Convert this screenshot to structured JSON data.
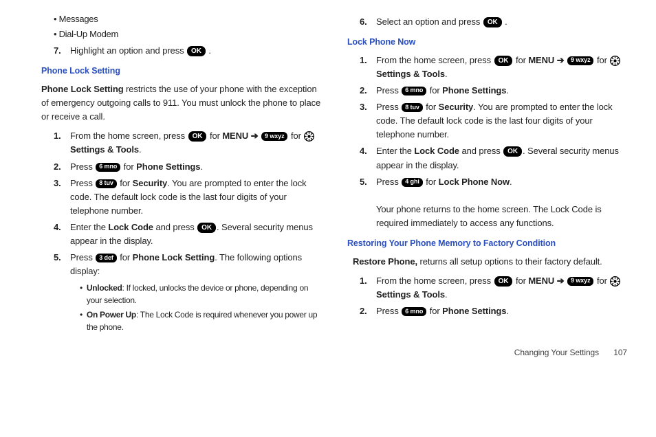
{
  "keys": {
    "ok": "OK",
    "k3": "3 def",
    "k4": "4 ghi",
    "k6": "6 mno",
    "k8": "8 tuv",
    "k9": "9 wxyz"
  },
  "labels": {
    "menu": "MENU",
    "settingsTools": "Settings & Tools",
    "phoneSettings": "Phone Settings",
    "security": "Security",
    "lockCode": "Lock Code",
    "phoneLockSetting": "Phone Lock Setting",
    "lockPhoneNow": "Lock Phone Now",
    "for": "for",
    "press": "Press",
    "enterThe": "Enter the",
    "andPress": "and press",
    "selectOptionPress": "Select an option and press",
    "fromHome": "From the home screen, press"
  },
  "left": {
    "bullets": [
      "Messages",
      "Dial-Up Modem"
    ],
    "step7": {
      "n": "7.",
      "pre": "Highlight an option and press"
    },
    "title1": "Phone Lock Setting",
    "intro_pre": "Phone Lock Setting",
    "intro_rest": " restricts the use of your phone with the exception of emergency outgoing calls to 911. You must unlock the phone to place or receive a call.",
    "steps": {
      "s1n": "1.",
      "s2n": "2.",
      "s3n": "3.",
      "s4n": "4.",
      "s5n": "5.",
      "s3_rest": ". You are prompted to enter the lock code. The default lock code is the last four digits of your telephone number.",
      "s4_rest": ". Several security menus appear in the display.",
      "s5_rest": ". The following options display:"
    },
    "subs": {
      "a_b": "Unlocked",
      "a_t": ": If locked, unlocks the device or phone, depending on your selection.",
      "b_b": "On Power Up",
      "b_t": ": The Lock Code is required whenever you power up the phone."
    }
  },
  "right": {
    "step6": {
      "n": "6."
    },
    "title1": "Lock Phone Now",
    "steps": {
      "s1n": "1.",
      "s2n": "2.",
      "s3n": "3.",
      "s4n": "4.",
      "s5n": "5.",
      "s3_rest": ". You are prompted to enter the lock code. The default lock code is the last four digits of your telephone number.",
      "s4_rest": ". Several security menus appear in the display.",
      "s5_after": "Your phone returns to the home screen. The Lock Code is required immediately to access any functions."
    },
    "title2": "Restoring Your Phone Memory to Factory Condition",
    "restore_b": "Restore Phone,",
    "restore_t": " returns all setup options to their factory default.",
    "rsteps": {
      "s1n": "1.",
      "s2n": "2."
    }
  },
  "footer": {
    "section": "Changing Your Settings",
    "page": "107"
  }
}
